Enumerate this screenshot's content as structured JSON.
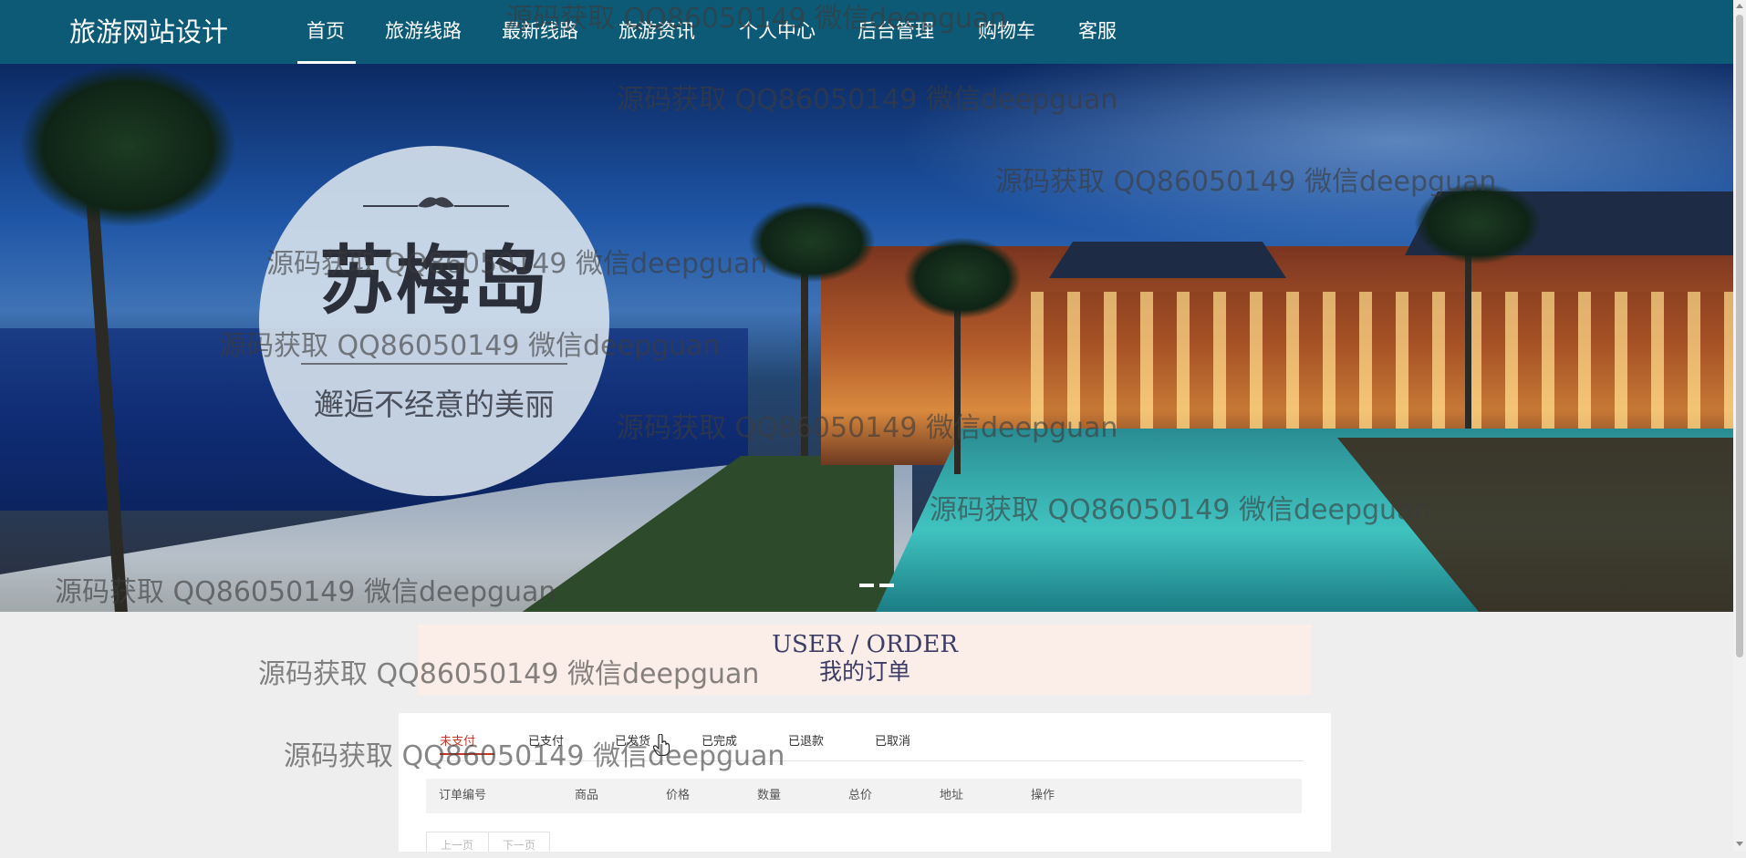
{
  "nav": {
    "brand": "旅游网站设计",
    "items": [
      {
        "label": "首页",
        "active": true
      },
      {
        "label": "旅游线路"
      },
      {
        "label": "最新线路"
      },
      {
        "label": "旅游资讯"
      },
      {
        "label": "个人中心"
      },
      {
        "label": "后台管理"
      },
      {
        "label": "购物车"
      },
      {
        "label": "客服"
      }
    ]
  },
  "banner": {
    "badge_title": "苏梅岛",
    "badge_subtitle": "邂逅不经意的美丽",
    "slides_count": 2,
    "active_slide": 1
  },
  "order_header": {
    "english": "USER / ORDER",
    "chinese": "我的订单"
  },
  "order_tabs": [
    {
      "label": "未支付",
      "active": true
    },
    {
      "label": "已支付"
    },
    {
      "label": "已发货"
    },
    {
      "label": "已完成"
    },
    {
      "label": "已退款"
    },
    {
      "label": "已取消"
    }
  ],
  "table_headers": [
    "订单编号",
    "商品",
    "价格",
    "数量",
    "总价",
    "地址",
    "操作"
  ],
  "pager": {
    "prev": "上一页",
    "next": "下一页"
  },
  "watermark": "源码获取 QQ86050149 微信deepguan",
  "colors": {
    "nav_bg": "#0d5a77",
    "order_header_bg": "#fbeee8",
    "active_tab": "#c0392b"
  },
  "icons": [
    "cursor-hand-icon",
    "scroll-up-icon",
    "scroll-down-icon"
  ]
}
